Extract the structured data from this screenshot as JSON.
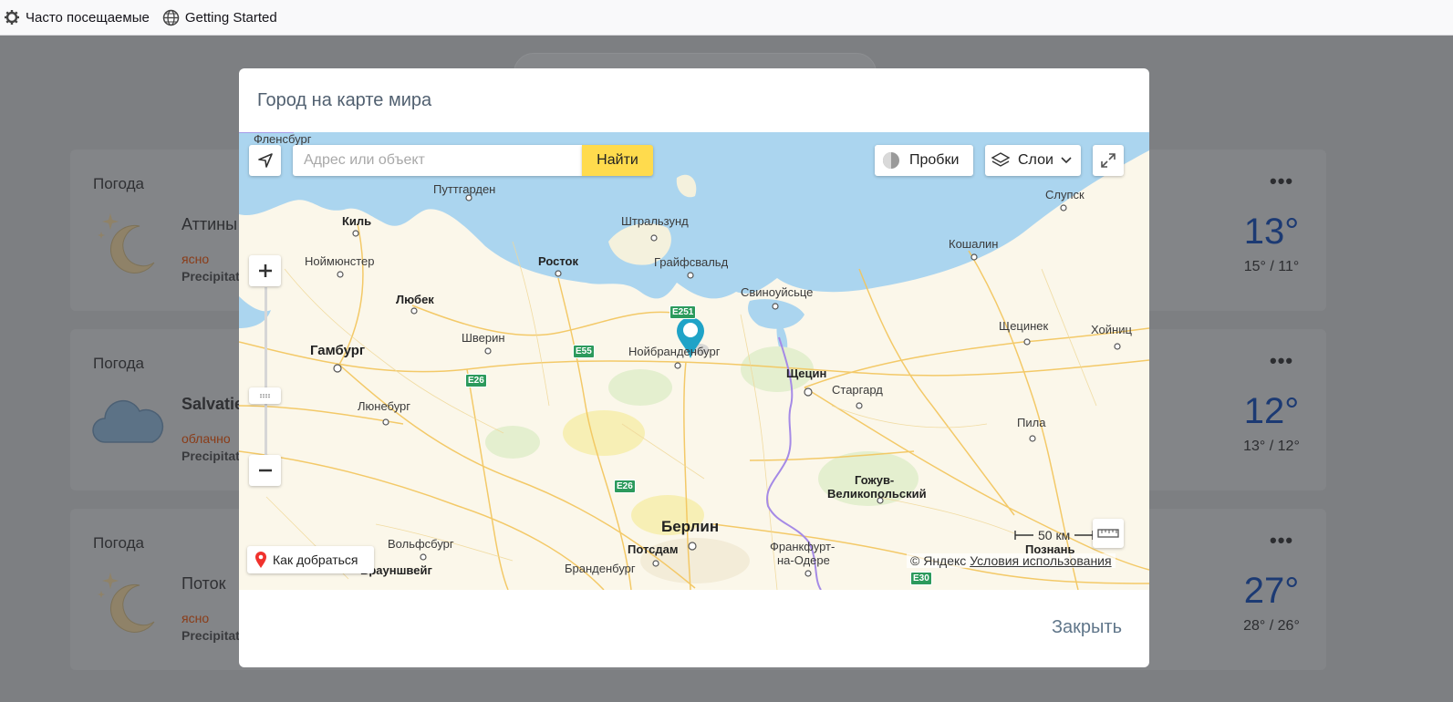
{
  "bookmarks": [
    {
      "label": "Часто посещаемые",
      "icon": "gear-icon"
    },
    {
      "label": "Getting Started",
      "icon": "globe-icon"
    }
  ],
  "cards": [
    {
      "title": "Погода",
      "city": "Аттины",
      "condition": "ясно",
      "precip": "Precipitat",
      "temp": "13°",
      "minmax": "15° / 11°",
      "icon": "moon-stars-icon"
    },
    {
      "title": "Погода",
      "city": "Salvatie",
      "condition": "облачно",
      "precip": "Precipitat",
      "temp": "12°",
      "minmax": "13° / 12°",
      "icon": "cloud-icon"
    },
    {
      "title": "Погода",
      "city": "Поток",
      "condition": "ясно",
      "precip": "Precipitat",
      "temp": "27°",
      "minmax": "28° / 26°",
      "icon": "moon-stars-icon"
    }
  ],
  "card_more_label": "•••",
  "modal": {
    "title": "Город на карте мира",
    "close_label": "Закрыть"
  },
  "map": {
    "search_placeholder": "Адрес или объект",
    "find_label": "Найти",
    "traffic_label": "Пробки",
    "layers_label": "Слои",
    "route_label": "Как добраться",
    "scale_label": "50 км",
    "copyright": "© Яндекс",
    "terms_label": "Условия использования",
    "labels": {
      "flensburg": "Фленсбург",
      "puttgarden": "Путтгарден",
      "kiel": "Киль",
      "stralsund": "Штральзунд",
      "slupsk": "Слупск",
      "rostock": "Росток",
      "greifswald": "Грайфсвальд",
      "koszalin": "Кошалин",
      "neumunster": "Ноймюнстер",
      "lubeck": "Любек",
      "swinoujscie": "Свиноуйсьце",
      "schwerin": "Шверин",
      "neubrandenburg": "Нойбранденбург",
      "szczecinek": "Щецинек",
      "chojnice": "Хойниц",
      "hamburg": "Гамбург",
      "szczecin": "Щецин",
      "stargard": "Старгард",
      "luneburg": "Люнебург",
      "pila": "Пила",
      "gorzow1": "Гожув-",
      "gorzow2": "Великопольский",
      "berlin": "Берлин",
      "wolfsburg": "Вольфсбург",
      "potsdam": "Потсдам",
      "frankfurt1": "Франкфурт-",
      "frankfurt2": "на-Одере",
      "poznan": "Познань",
      "braunschweig": "Брауншвейг",
      "brandenburg": "Бранденбург"
    },
    "routes": [
      "E251",
      "E55",
      "E26",
      "E26",
      "E30"
    ]
  }
}
